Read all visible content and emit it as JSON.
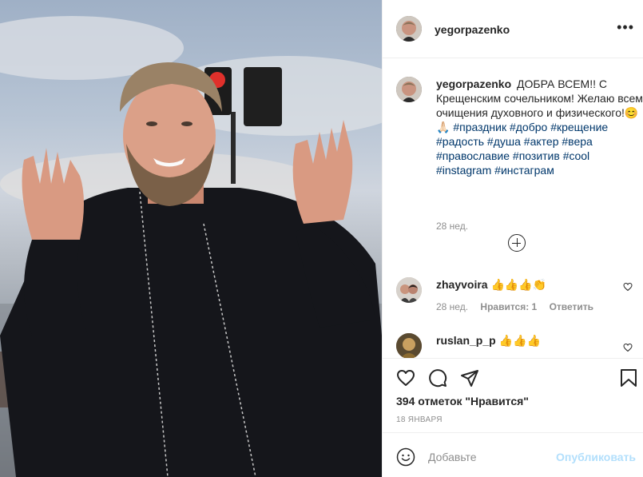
{
  "post": {
    "username": "yegorpazenko",
    "more_icon": "more-horizontal-icon",
    "caption": {
      "username": "yegorpazenko",
      "text": "ДОБРА ВСЕМ!! С Крещенским сочельником! Желаю всем очищения духовного и физического!😊🙏🏻",
      "hashtags": [
        "#праздник",
        "#добро",
        "#крещение",
        "#радость",
        "#душа",
        "#актер",
        "#вера",
        "#православие",
        "#позитив",
        "#cool",
        "#instagram",
        "#инстаграм"
      ],
      "time": "28 нед."
    },
    "comments": [
      {
        "username": "zhayvoira",
        "text": "👍👍👍👏",
        "time": "28 нед.",
        "likes": "Нравится: 1",
        "reply": "Ответить"
      },
      {
        "username": "ruslan_p_p",
        "text": "👍👍👍"
      }
    ],
    "likes_text": "394 отметок \"Нравится\"",
    "date": "18 ЯНВАРЯ",
    "add_comment_placeholder": "Добавьте",
    "publish_label": "Опубликовать"
  },
  "colors": {
    "link": "#00376b",
    "muted": "#8e8e8e",
    "publish_disabled": "#b2dffc"
  }
}
